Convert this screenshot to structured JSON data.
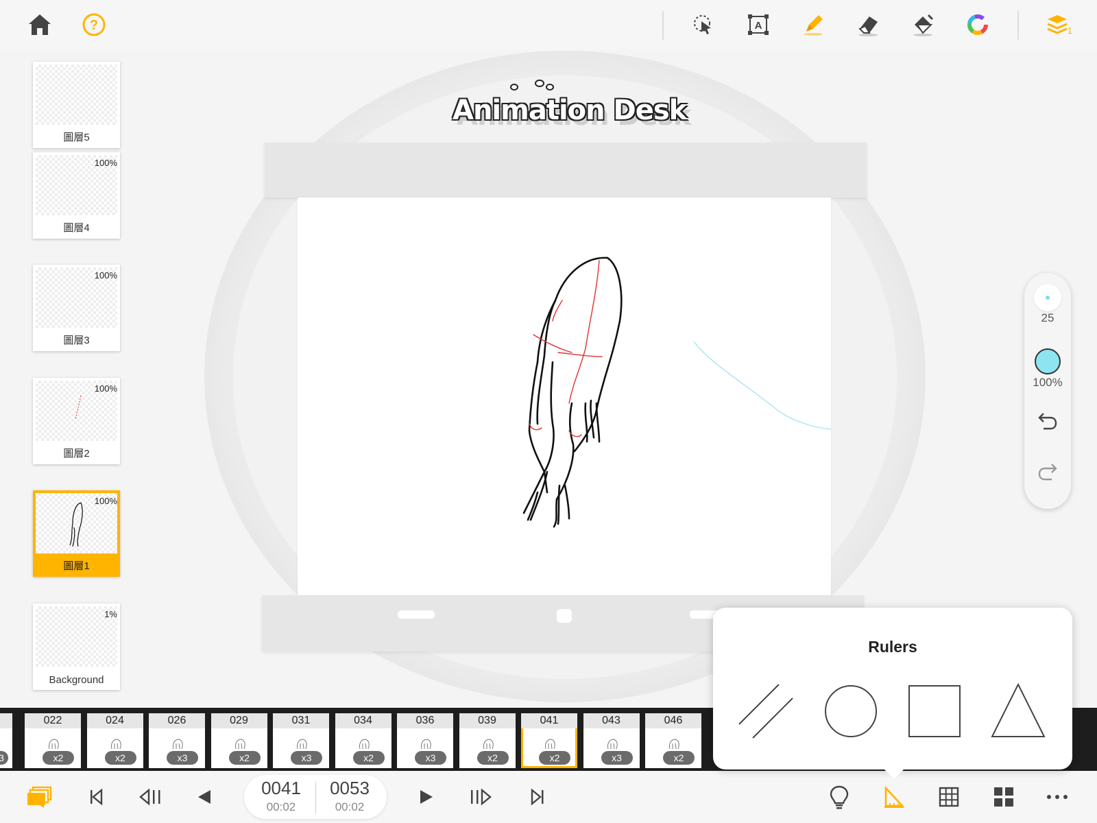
{
  "app": {
    "logo_text": "Animation Desk"
  },
  "toolbar": {
    "home": "home-icon",
    "help": "help-icon",
    "tools": [
      "lasso-select-icon",
      "text-tool-icon",
      "pen-tool-icon",
      "eraser-icon",
      "fill-bucket-icon",
      "color-wheel-icon"
    ],
    "layers_badge": "1"
  },
  "colors": {
    "accent": "#ffb400",
    "brush": "#8ee4f1"
  },
  "layers": [
    {
      "name": "圖層5",
      "opacity": ""
    },
    {
      "name": "圖層4",
      "opacity": "100%"
    },
    {
      "name": "圖層3",
      "opacity": "100%"
    },
    {
      "name": "圖層2",
      "opacity": "100%"
    },
    {
      "name": "圖層1",
      "opacity": "100%",
      "active": true
    },
    {
      "name": "Background",
      "opacity": "1%"
    }
  ],
  "brush": {
    "size": "25",
    "opacity": "100%"
  },
  "timeline": {
    "partial_left_badge": "3",
    "frames": [
      {
        "num": "022",
        "dup": "x2"
      },
      {
        "num": "024",
        "dup": "x2"
      },
      {
        "num": "026",
        "dup": "x3"
      },
      {
        "num": "029",
        "dup": "x2"
      },
      {
        "num": "031",
        "dup": "x3"
      },
      {
        "num": "034",
        "dup": "x2"
      },
      {
        "num": "036",
        "dup": "x3"
      },
      {
        "num": "039",
        "dup": "x2"
      },
      {
        "num": "041",
        "dup": "x2",
        "active": true
      },
      {
        "num": "043",
        "dup": "x3"
      },
      {
        "num": "046",
        "dup": "x2"
      }
    ]
  },
  "counter": {
    "current_frame": "0041",
    "current_time": "00:02",
    "total_frame": "0053",
    "total_time": "00:02"
  },
  "rulers_popover": {
    "title": "Rulers",
    "options": [
      "parallel-lines-ruler-icon",
      "circle-ruler-icon",
      "square-ruler-icon",
      "triangle-ruler-icon"
    ]
  }
}
